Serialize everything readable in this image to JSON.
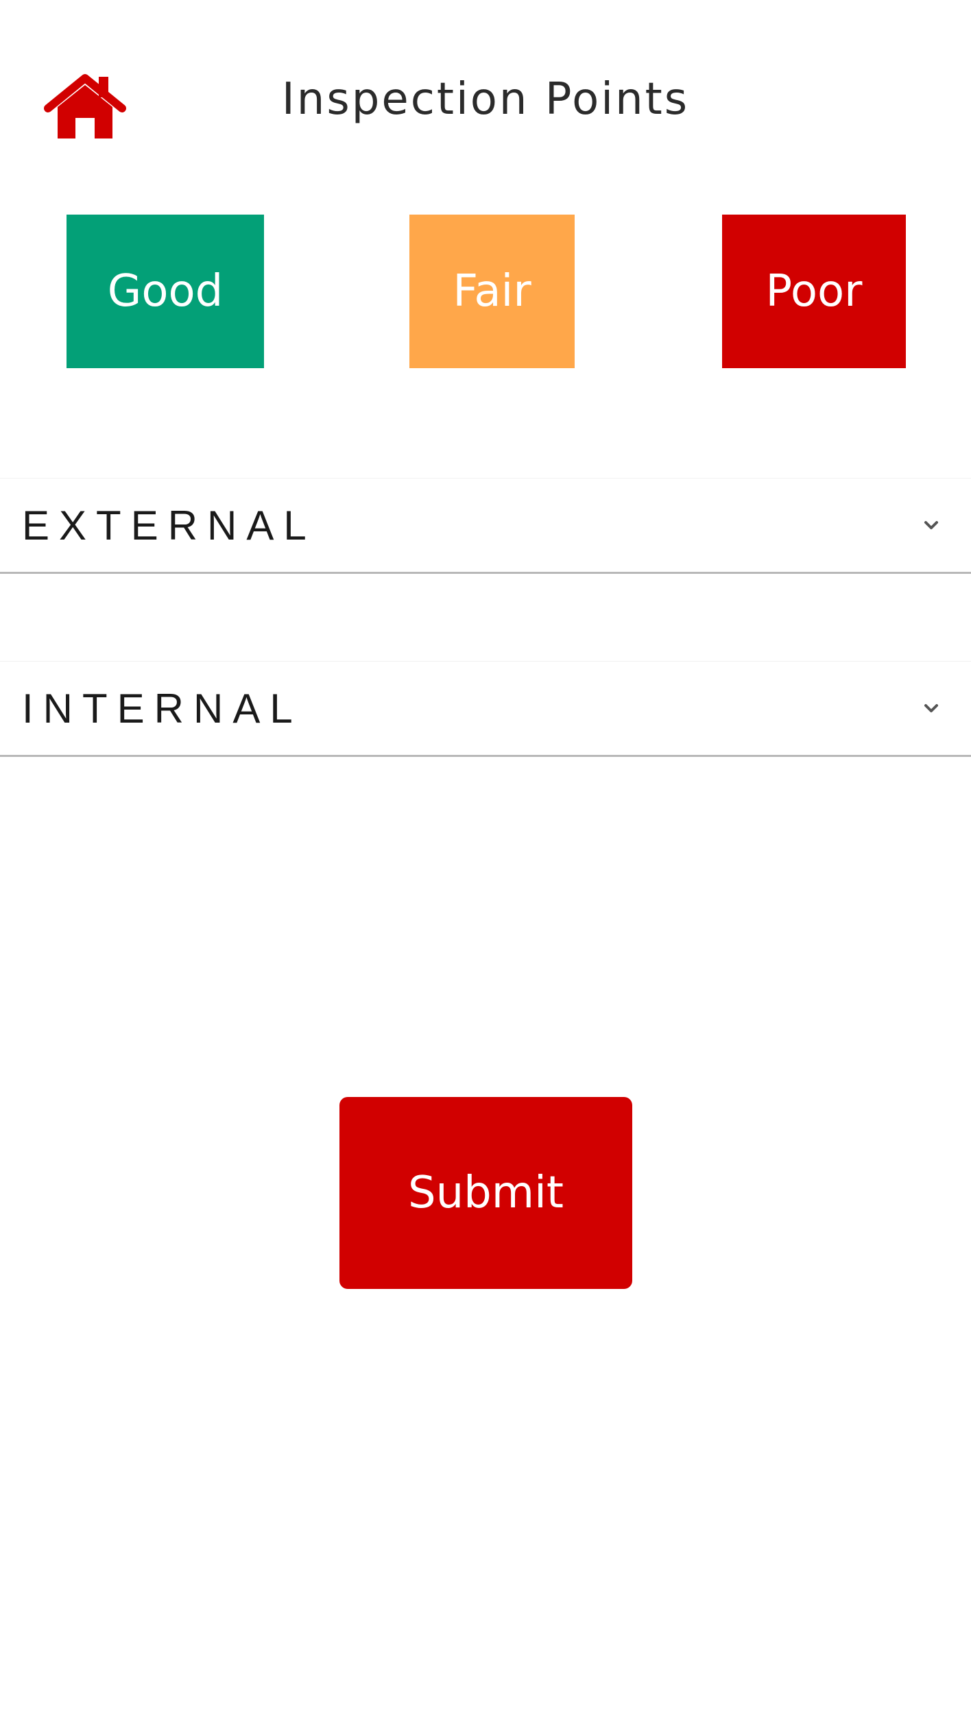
{
  "header": {
    "home_icon": "home-icon",
    "title": "Inspection Points"
  },
  "ratings": [
    {
      "label": "Good",
      "color": "#03a077"
    },
    {
      "label": "Fair",
      "color": "#ffa74a"
    },
    {
      "label": "Poor",
      "color": "#d10000"
    }
  ],
  "sections": [
    {
      "label": "EXTERNAL",
      "icon": "chevron-down-icon"
    },
    {
      "label": "INTERNAL",
      "icon": "chevron-down-icon"
    }
  ],
  "submit": {
    "label": "Submit",
    "color": "#d10000"
  },
  "colors": {
    "accent": "#d10000",
    "divider": "#b8b8b8",
    "title_text": "#2b2b2b"
  }
}
